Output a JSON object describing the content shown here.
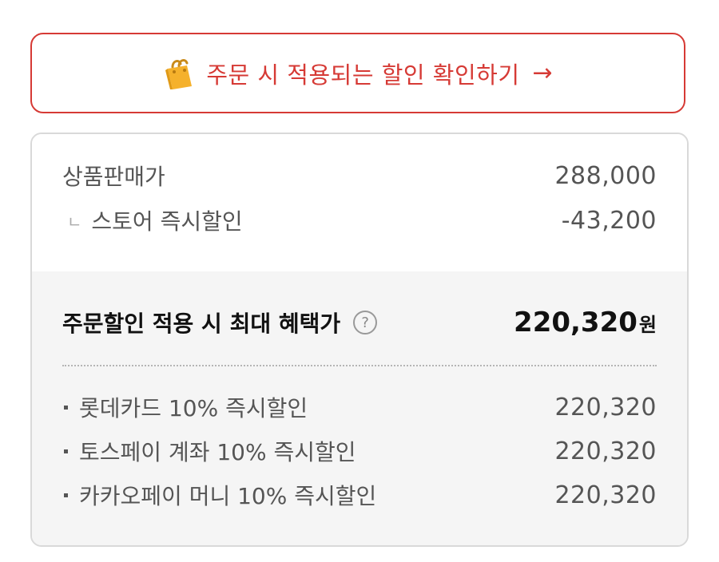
{
  "cta": {
    "icon": "shopping-bag-icon",
    "label": "주문 시 적용되는 할인 확인하기",
    "arrow": "→",
    "color": "#d63a35"
  },
  "price": {
    "sale_label": "상품판매가",
    "sale_value": "288,000",
    "store_discount_marker": "ㄴ",
    "store_discount_label": "스토어 즉시할인",
    "store_discount_value": "-43,200"
  },
  "benefit": {
    "label": "주문할인 적용 시 최대 혜택가",
    "help": "?",
    "amount": "220,320",
    "unit": "원"
  },
  "discounts": [
    {
      "label": "롯데카드 10% 즉시할인",
      "value": "220,320"
    },
    {
      "label": "토스페이 계좌 10% 즉시할인",
      "value": "220,320"
    },
    {
      "label": "카카오페이 머니 10% 즉시할인",
      "value": "220,320"
    }
  ]
}
